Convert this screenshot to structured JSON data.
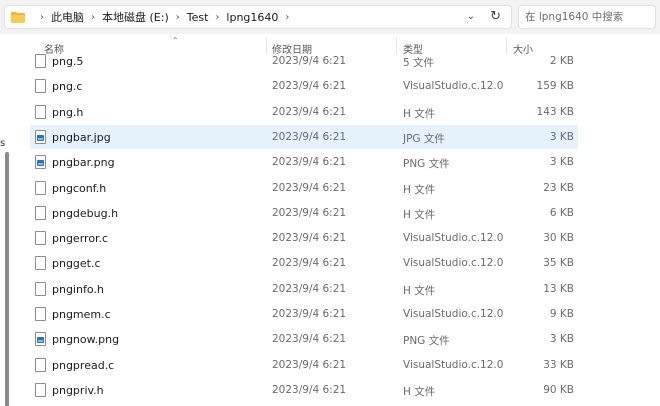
{
  "address": {
    "crumbs": [
      "此电脑",
      "本地磁盘 (E:)",
      "Test",
      "lpng1640"
    ],
    "separator": "›",
    "trailing_separator": "›"
  },
  "search": {
    "placeholder": "在 lpng1640 中搜索"
  },
  "left_pane": {
    "label": "s"
  },
  "columns": {
    "name": "名称",
    "date": "修改日期",
    "type": "类型",
    "size": "大小"
  },
  "files": [
    {
      "name": "png.5",
      "date": "2023/9/4 6:21",
      "type": "5 文件",
      "size": "2 KB",
      "icon": "document-icon",
      "selected": false
    },
    {
      "name": "png.c",
      "date": "2023/9/4 6:21",
      "type": "VisualStudio.c.12.0",
      "size": "159 KB",
      "icon": "document-icon",
      "selected": false
    },
    {
      "name": "png.h",
      "date": "2023/9/4 6:21",
      "type": "H 文件",
      "size": "143 KB",
      "icon": "document-icon",
      "selected": false
    },
    {
      "name": "pngbar.jpg",
      "date": "2023/9/4 6:21",
      "type": "JPG 文件",
      "size": "3 KB",
      "icon": "image-file-icon",
      "selected": true
    },
    {
      "name": "pngbar.png",
      "date": "2023/9/4 6:21",
      "type": "PNG 文件",
      "size": "3 KB",
      "icon": "image-file-icon",
      "selected": false
    },
    {
      "name": "pngconf.h",
      "date": "2023/9/4 6:21",
      "type": "H 文件",
      "size": "23 KB",
      "icon": "document-icon",
      "selected": false
    },
    {
      "name": "pngdebug.h",
      "date": "2023/9/4 6:21",
      "type": "H 文件",
      "size": "6 KB",
      "icon": "document-icon",
      "selected": false
    },
    {
      "name": "pngerror.c",
      "date": "2023/9/4 6:21",
      "type": "VisualStudio.c.12.0",
      "size": "30 KB",
      "icon": "document-icon",
      "selected": false
    },
    {
      "name": "pngget.c",
      "date": "2023/9/4 6:21",
      "type": "VisualStudio.c.12.0",
      "size": "35 KB",
      "icon": "document-icon",
      "selected": false
    },
    {
      "name": "pnginfo.h",
      "date": "2023/9/4 6:21",
      "type": "H 文件",
      "size": "13 KB",
      "icon": "document-icon",
      "selected": false
    },
    {
      "name": "pngmem.c",
      "date": "2023/9/4 6:21",
      "type": "VisualStudio.c.12.0",
      "size": "9 KB",
      "icon": "document-icon",
      "selected": false
    },
    {
      "name": "pngnow.png",
      "date": "2023/9/4 6:21",
      "type": "PNG 文件",
      "size": "3 KB",
      "icon": "image-file-icon",
      "selected": false
    },
    {
      "name": "pngpread.c",
      "date": "2023/9/4 6:21",
      "type": "VisualStudio.c.12.0",
      "size": "33 KB",
      "icon": "document-icon",
      "selected": false
    },
    {
      "name": "pngpriv.h",
      "date": "2023/9/4 6:21",
      "type": "H 文件",
      "size": "90 KB",
      "icon": "document-icon",
      "selected": false
    }
  ],
  "colors": {
    "selection": "#e5f1fb",
    "folder": "#f6ca56",
    "image_icon": "#2f6fb5"
  }
}
